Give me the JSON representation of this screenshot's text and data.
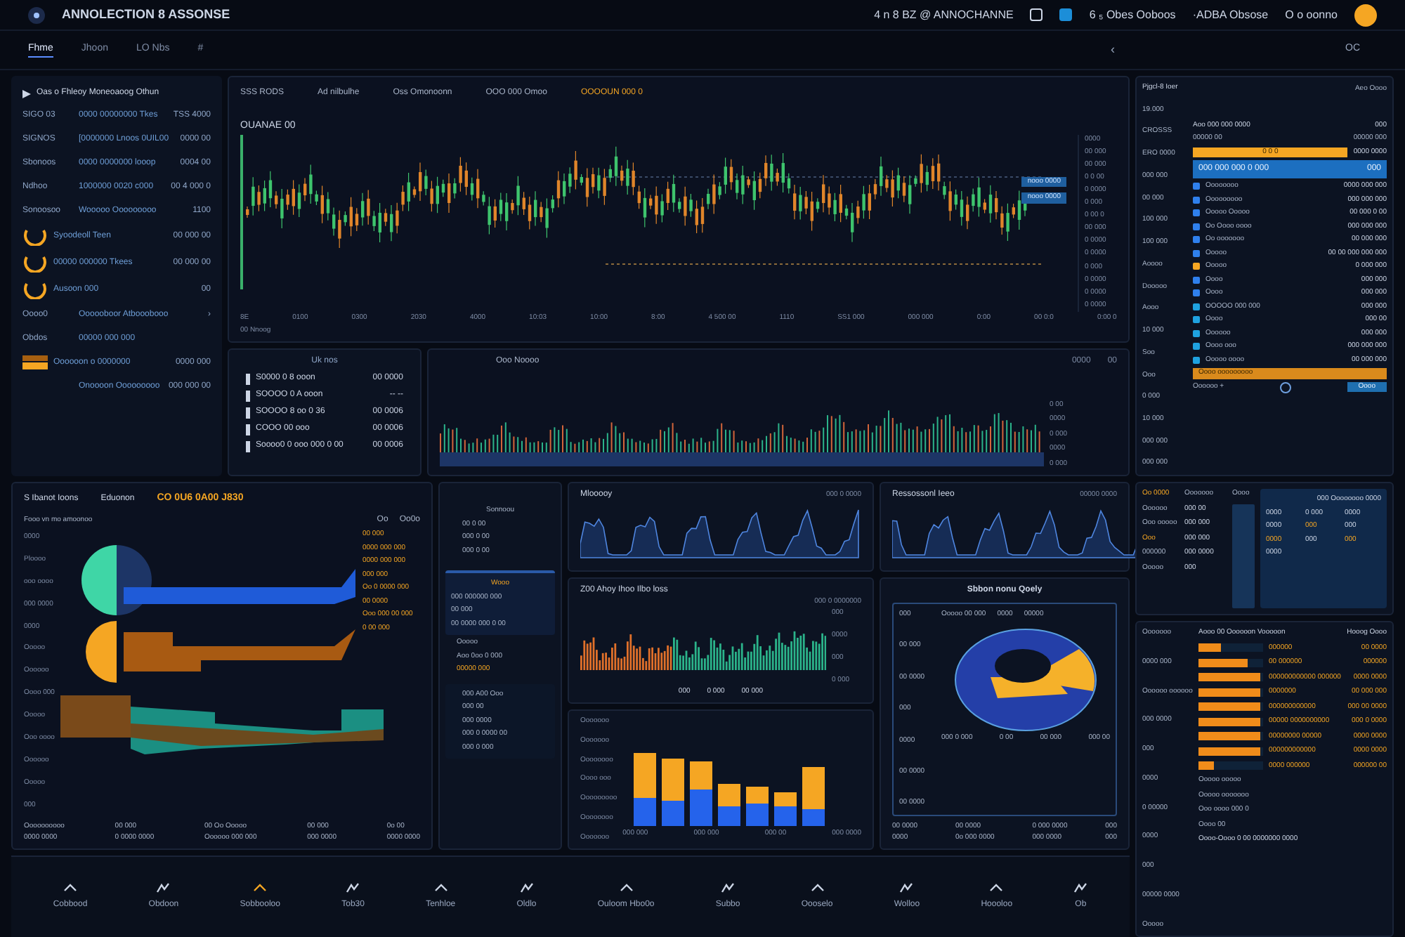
{
  "header": {
    "title": "ANNOLECTION 8 ASSONSE",
    "status_items": [
      "4 n 8 BZ @ ANNOCHANNE",
      "6 ₅ Obes Ooboos",
      "·ADBA Obsose",
      "O o oonno"
    ]
  },
  "subnav": {
    "tabs": [
      {
        "label": "Fhme",
        "selected": true
      },
      {
        "label": "Jhoon",
        "selected": false
      },
      {
        "label": "LO Nbs",
        "selected": false
      },
      {
        "label": "#",
        "selected": false
      }
    ],
    "right": [
      "‹",
      "OC"
    ]
  },
  "left_list": {
    "title": "Oas o Fhleoy Moneoaoog Othun",
    "rows": [
      {
        "kind": "text",
        "label": "SIGO 03",
        "text": "0000 00000000 Tkes",
        "value": "TSS 4000"
      },
      {
        "kind": "text",
        "label": "SIGNOS",
        "text": "[0000000 Lnoos 0UIL00",
        "value": "0000 00"
      },
      {
        "kind": "text",
        "label": "Sbonoos",
        "text": "0000 0000000 looop",
        "value": "0004 00"
      },
      {
        "kind": "text",
        "label": "Ndhoo",
        "text": "1000000 0020 c000",
        "value": "00 4 000 0"
      },
      {
        "kind": "text",
        "label": "Sonoosoo",
        "text": "Wooooo Ooooooooo",
        "value": "1100"
      },
      {
        "kind": "gauge",
        "label": "",
        "text": "Syoodeoll Teen",
        "value": "00 000 00"
      },
      {
        "kind": "gauge",
        "label": "",
        "text": "00000 000000 Tkees",
        "value": "00 000 00"
      },
      {
        "kind": "gauge",
        "label": "",
        "text": "Ausoon 000",
        "value": "00"
      },
      {
        "kind": "text",
        "label": "Oooo0",
        "text": "Oooooboor Atbooobooo",
        "value": "›"
      },
      {
        "kind": "text",
        "label": "Obdos",
        "text": "00000 000 000",
        "value": ""
      },
      {
        "kind": "bar",
        "label": "",
        "text": "Oooooon o 0000000",
        "value": "0000 000"
      },
      {
        "kind": "text",
        "label": "",
        "text": "Onoooon Ooooooooo",
        "value": "000 000 00"
      }
    ]
  },
  "candles": {
    "labels": [
      "SSS RODS",
      "Ad nilbulhe",
      "Oss Omonoonn",
      "OOO 000 Omoo"
    ],
    "accent": "OOOOUN 000 0",
    "price": "OUANAE  00",
    "xticks": [
      "8E",
      "0100",
      "0300",
      "2030",
      "4000",
      "10:03",
      "10:00",
      "8:00",
      "4 500 00",
      "1110",
      "SS1 000",
      "000 000",
      "0:00",
      "00 0:0",
      "0:00 0"
    ],
    "yticks": [
      "0000",
      "00 000",
      "00 000",
      "0 0 00",
      "0 0000",
      "0 000",
      "0 00 0",
      "00 000",
      "0 0000",
      "0 0000",
      "0 000",
      "0 0000",
      "0 0000",
      "0 0000"
    ],
    "tags": [
      "nooo 0000",
      "nooo 0000"
    ],
    "footer": "00 Nnoog"
  },
  "ticker": {
    "title": "Uk nos",
    "rows": [
      {
        "text": "S0000 0 8 ooon",
        "value": "00 0000"
      },
      {
        "text": "SOOOO 0 A ooon",
        "value": "-- --"
      },
      {
        "text": "SOOOO 8 oo 0 36",
        "value": "00 0006"
      },
      {
        "text": "COOO  00 ooo",
        "value": "00 0006"
      },
      {
        "text": "Soooo0 0 ooo  000 0 00",
        "value": "00 0006"
      }
    ]
  },
  "volume": {
    "title": "Ooo Noooo",
    "controls": [
      "0000",
      "00"
    ],
    "side": [
      "0 00",
      "0000",
      "0 000",
      "0000",
      "0 000"
    ]
  },
  "right_panel": {
    "title": "Pjgcl-8 Ioer",
    "action": "Aeo Oooo",
    "labels": [
      "19.000",
      "CROSSS",
      "ERO 0000",
      "000 000",
      "00 000",
      "100 000",
      "100 000",
      "Aoooo",
      "Dooooo",
      "Aooo",
      "10 000",
      "Soo",
      "Ooo",
      "0 000",
      "10 000",
      "000 000",
      "000 000"
    ],
    "header_row": [
      "Aoo 000 000 0000",
      "000"
    ],
    "sub_row": [
      "00000 00",
      "00000 000"
    ],
    "orange_bar": {
      "text": "0 0 0",
      "value": "0000 0000"
    },
    "blue_bar": {
      "text": "000 000 000 0 000",
      "value": "000"
    },
    "items": [
      {
        "name": "Oooooooo",
        "value": "0000 000 000",
        "color": "#2f80ed"
      },
      {
        "name": "Ooooooooo",
        "value": "000 000 000",
        "color": "#2f80ed"
      },
      {
        "name": "Ooooo Ooooo",
        "value": "00 000 0 00",
        "color": "#2f80ed"
      },
      {
        "name": "Oo Oooo oooo",
        "value": "000 000 000",
        "color": "#2f80ed"
      },
      {
        "name": "Oo ooooooo",
        "value": "00  000 000",
        "color": "#2f80ed"
      },
      {
        "name": "Ooooo",
        "value": "00 00  000 000 000",
        "color": "#2f80ed"
      },
      {
        "name": "Ooooo",
        "value": "0 000 000",
        "color": "#f5a623"
      },
      {
        "name": "Oooo",
        "value": "000 000",
        "color": "#2f80ed"
      },
      {
        "name": "Oooo",
        "value": "000 000",
        "color": "#2f80ed"
      },
      {
        "name": "OOOOO 000 000",
        "value": "000 000",
        "color": "#1fa2e0"
      },
      {
        "name": "Oooo",
        "value": "000 00",
        "color": "#1fa2e0"
      },
      {
        "name": "Oooooo",
        "value": "000 000",
        "color": "#1fa2e0"
      },
      {
        "name": "Oooo ooo",
        "value": "000 000 000",
        "color": "#1fa2e0"
      },
      {
        "name": "Ooooo oooo",
        "value": "00 000 000",
        "color": "#1fa2e0"
      }
    ],
    "bottom_bar": "Oooo ooooooooo",
    "footer_note": "Oooooo  +",
    "button": "Oooo"
  },
  "panel_a": {
    "tabs": [
      "S Ibanot Ioons",
      "Eduonon"
    ],
    "accent": "CO 0U6 0A00 J830",
    "subtitle": "Fooo vn mo amoonoo",
    "controls": [
      "Oo",
      "Oo0o"
    ],
    "axis": [
      "0000",
      "Ploooo",
      "ooo oooo",
      "000 0000",
      "0000",
      "Ooooo",
      "Oooooo",
      "Oooo 000",
      "Ooooo",
      "Ooo oooo",
      "Oooooo",
      "Ooooo",
      "000"
    ],
    "callouts": [
      "00 000",
      "0000  000 000",
      "0000  000 000",
      "000 000",
      "Oo  0 0000 000",
      "00 0000",
      "Ooo 000  00 000",
      "0 00 000"
    ],
    "footer": [
      [
        "Oooooooooo",
        "0000 0000"
      ],
      [
        "00 000",
        "0 0000 0000"
      ],
      [
        "00 Oo Ooooo",
        "Oooooo 000 000"
      ],
      [
        "00 000",
        "000 0000"
      ],
      [
        "0o 00",
        "0000 0000"
      ]
    ]
  },
  "panel_b": {
    "title": "Sonnoou",
    "rows": [
      "00 0  00",
      "000 0  00",
      "000 0 00"
    ],
    "card": [
      "Wooo",
      "000 000000  000",
      "00 000",
      "00 0000 000 0  00"
    ],
    "mid": [
      "Ooooo",
      "Aoo 0oo  0  000",
      "00000  000"
    ],
    "low": [
      "000 A00  Ooo",
      "000  00",
      "000  0000",
      "000  0 0000 00",
      "000  0  000"
    ]
  },
  "area_panels": [
    {
      "title": "Mlooooy",
      "note": "000 0 0000"
    },
    {
      "title": "Ressossonl Ieeo",
      "note": "00000 0000"
    }
  ],
  "hist_panel": {
    "title": "Z00 Ahoy Ihoo Ilbo loss",
    "note": "000 0 0000000",
    "legend": [
      "000",
      "0000",
      "000",
      "0 000"
    ],
    "stats": [
      "000",
      "0 000",
      "00 000"
    ]
  },
  "stack_panel": {
    "labels": [
      "Ooooooo",
      "Ooooooo",
      "Oooooooo",
      "Oooo ooo",
      "Ooooooooo",
      "Oooooooo",
      "Ooooooo"
    ],
    "ticks": [
      "000  000",
      "000  000",
      "000 00",
      "000 0000"
    ]
  },
  "donut_panel": {
    "title": "Sbbon nonu Qoely",
    "legend": [
      "Ooooo 00 000",
      "0000",
      "00000"
    ],
    "side": [
      "000",
      "00 000",
      "00 0000",
      "000",
      "0000",
      "00 0000",
      "00 0000"
    ],
    "labels": [
      "000 0 000",
      "0 00",
      "00 000",
      "000 00"
    ],
    "stats": [
      [
        "00 0000",
        "0000"
      ],
      [
        "00 0000",
        "0o 000 0000"
      ],
      [
        "0 000 0000",
        "000 0000"
      ],
      [
        "000",
        "000"
      ]
    ]
  },
  "right_table": {
    "head": [
      "Oo 0000",
      "Ooooooo",
      "Oooo"
    ],
    "labels": [
      "Oooooo",
      "Ooo ooooo",
      "Ooo",
      "000000",
      "Ooooo"
    ],
    "values": [
      "000 00",
      "000 000",
      "000 000",
      "000 0000",
      "000"
    ],
    "grid": [
      "000 Oooooooo 0000",
      "0000",
      "0 000",
      "0000",
      "0000",
      "000",
      "000",
      "0000",
      "000",
      "000",
      "0000"
    ]
  },
  "bars_panel": {
    "title": "Aooo 00 Oooooon Vooooon",
    "aside": "Hooog Oooo",
    "label_col": [
      "Ooooooo",
      "0000 000",
      "Oooooo oooooo",
      "000 0000",
      "000",
      "0000",
      "0 00000",
      "0000",
      "000",
      "00000 0000",
      "Ooooo"
    ],
    "bars": [
      {
        "text": "000000",
        "level": 0.34,
        "value": "00 0000"
      },
      {
        "text": "00 000000",
        "level": 0.76,
        "value": "000000"
      },
      {
        "text": "000000000000 000000",
        "level": 0.96,
        "value": "0000 0000"
      },
      {
        "text": "0000000",
        "level": 0.96,
        "value": "00 000 000"
      },
      {
        "text": "000000000000",
        "level": 0.96,
        "value": "000 00 0000"
      },
      {
        "text": "00000 0000000000",
        "level": 0.96,
        "value": "000 0 0000"
      },
      {
        "text": "00000000  00000",
        "level": 0.96,
        "value": "0000 0000"
      },
      {
        "text": "000000000000",
        "level": 0.96,
        "value": "0000 0000"
      },
      {
        "text": "0000 000000",
        "level": 0.24,
        "value": "000000 00"
      }
    ],
    "notes": [
      "Ooooo ooooo",
      "Ooooo ooooooo",
      "Ooo oooo  000  0",
      "Oooo 00"
    ],
    "footer": "Oooo-Oooo 0 00 0000000 0000"
  },
  "toolbar": {
    "items": [
      "Cobbood",
      "Obdoon",
      "Sobbooloo",
      "Tob30",
      "Tenhloe",
      "Oldlo",
      "Ouloom  Hbo0o",
      "Subbo",
      "Oooselo",
      "Wolloo",
      "Hoooloo",
      "Ob"
    ]
  }
}
